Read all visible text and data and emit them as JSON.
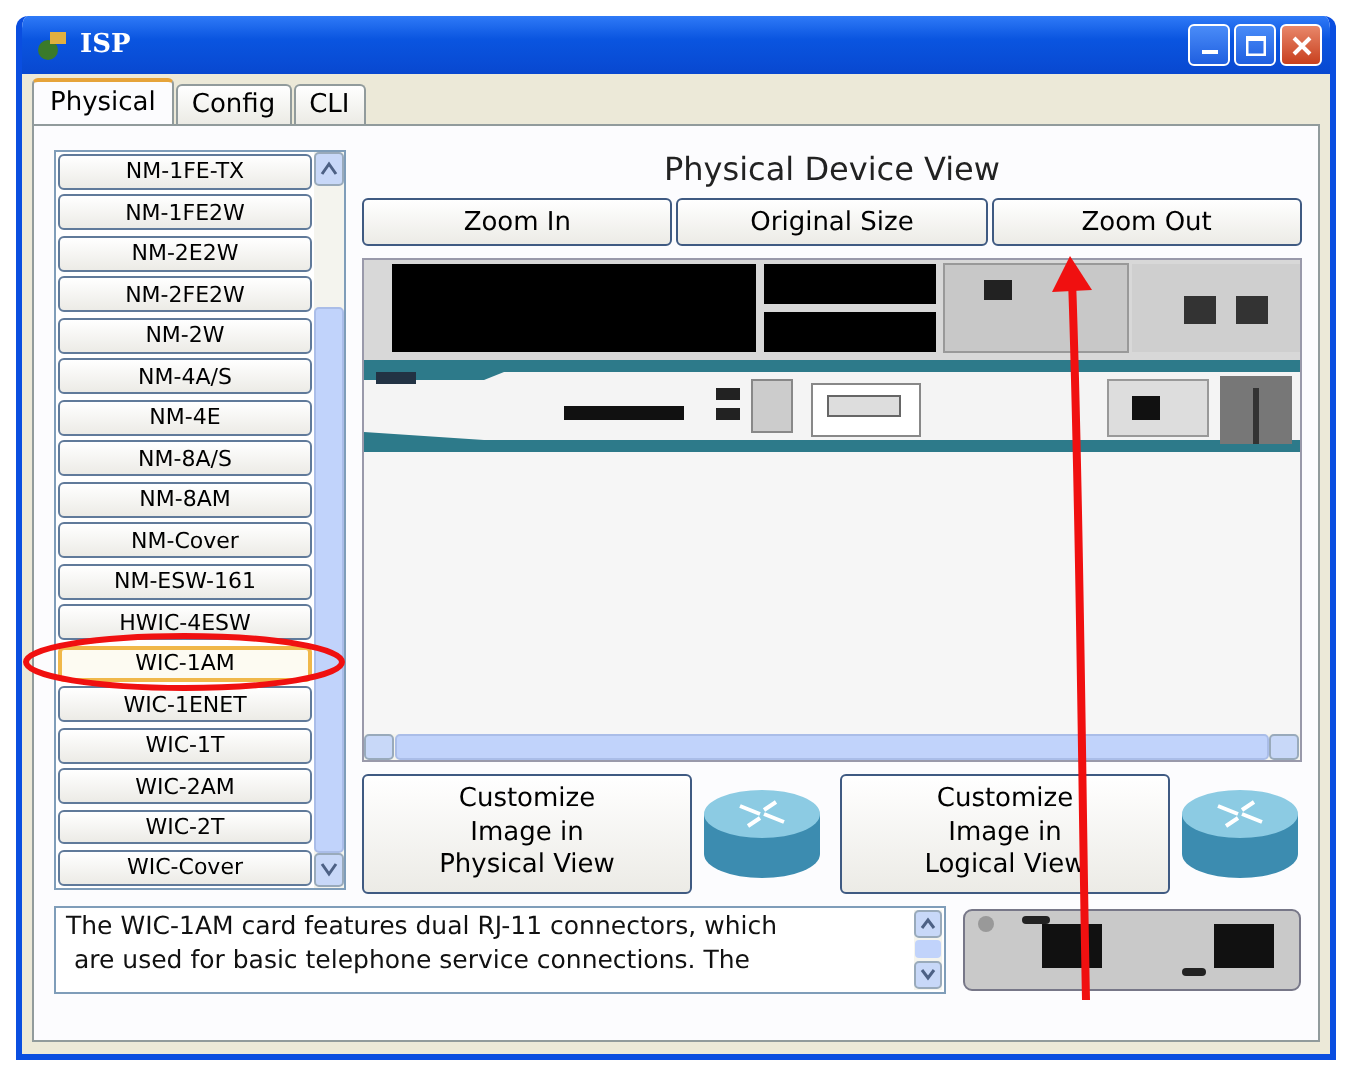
{
  "window": {
    "title": "ISP"
  },
  "tabs": [
    {
      "label": "Physical",
      "selected": true
    },
    {
      "label": "Config",
      "selected": false
    },
    {
      "label": "CLI",
      "selected": false
    }
  ],
  "modules": [
    {
      "label": "NM-1FE-TX",
      "selected": false
    },
    {
      "label": "NM-1FE2W",
      "selected": false
    },
    {
      "label": "NM-2E2W",
      "selected": false
    },
    {
      "label": "NM-2FE2W",
      "selected": false
    },
    {
      "label": "NM-2W",
      "selected": false
    },
    {
      "label": "NM-4A/S",
      "selected": false
    },
    {
      "label": "NM-4E",
      "selected": false
    },
    {
      "label": "NM-8A/S",
      "selected": false
    },
    {
      "label": "NM-8AM",
      "selected": false
    },
    {
      "label": "NM-Cover",
      "selected": false
    },
    {
      "label": "NM-ESW-161",
      "selected": false
    },
    {
      "label": "HWIC-4ESW",
      "selected": false
    },
    {
      "label": "WIC-1AM",
      "selected": true
    },
    {
      "label": "WIC-1ENET",
      "selected": false
    },
    {
      "label": "WIC-1T",
      "selected": false
    },
    {
      "label": "WIC-2AM",
      "selected": false
    },
    {
      "label": "WIC-2T",
      "selected": false
    },
    {
      "label": "WIC-Cover",
      "selected": false
    }
  ],
  "device_view": {
    "title": "Physical Device View",
    "buttons": [
      "Zoom In",
      "Original Size",
      "Zoom Out"
    ]
  },
  "customize_buttons": [
    "Customize\nImage in\nPhysical View",
    "Customize\nImage in\nLogical View"
  ],
  "description": "The WIC-1AM card features dual RJ-11 connectors, which\n are used for basic telephone service connections. The"
}
